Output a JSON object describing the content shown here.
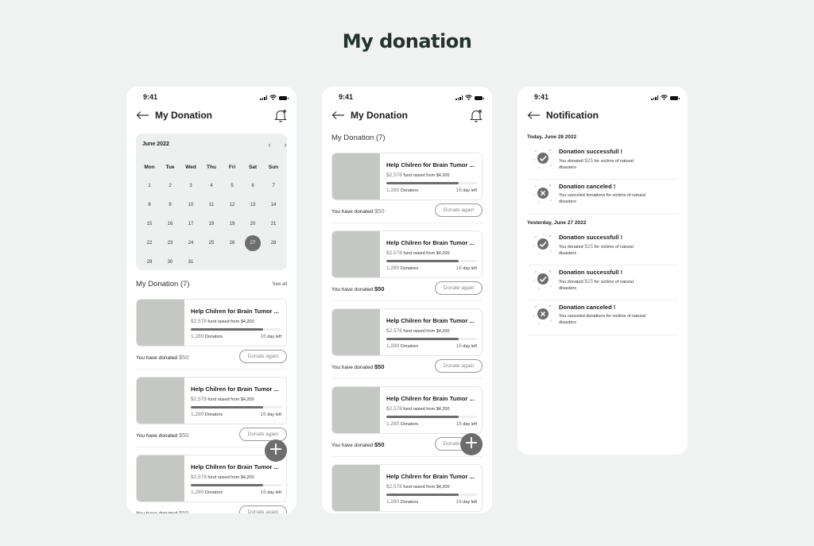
{
  "page_title": "My donation",
  "status": {
    "time": "9:41"
  },
  "screen1": {
    "title": "My Donation",
    "calendar": {
      "month": "June 2022",
      "weekdays": [
        "Mon",
        "Tue",
        "Wed",
        "Thu",
        "Fri",
        "Sat",
        "Sun"
      ],
      "weeks": [
        [
          "1",
          "2",
          "3",
          "4",
          "5",
          "6",
          "7"
        ],
        [
          "8",
          "9",
          "10",
          "11",
          "12",
          "13",
          "14"
        ],
        [
          "15",
          "16",
          "17",
          "18",
          "19",
          "20",
          "21"
        ],
        [
          "22",
          "23",
          "24",
          "25",
          "26",
          "27",
          "28"
        ],
        [
          "29",
          "30",
          "31",
          "",
          "",
          "",
          ""
        ]
      ],
      "selected": "27"
    },
    "section_title": "My Donation (7)",
    "see_all": "See all"
  },
  "screen2": {
    "title": "My Donation",
    "section_title": "My Donation (7)"
  },
  "card": {
    "title": "Help Chilren for Brain Tumor ...",
    "raised_amount": "$2,578",
    "raised_text": "fund raised from $4,200",
    "progress": 0.8,
    "donators_count": "1,280",
    "donators_label": "Donators",
    "days_count": "16",
    "days_label": "day left",
    "donated_prefix": "You have donated",
    "donated_value": "$50",
    "donate_again": "Donate again"
  },
  "screen3": {
    "title": "Notification",
    "groups": [
      {
        "date": "Today, June 28 2022",
        "items": [
          {
            "type": "success",
            "title": "Donation successfull !",
            "desc_prefix": "You donated",
            "amount": "$25",
            "desc_suffix": "for victims of natural disasters"
          },
          {
            "type": "cancel",
            "title": "Donation canceled !",
            "desc_prefix": "You canceled donations for victims of natural disasters",
            "amount": "",
            "desc_suffix": ""
          }
        ]
      },
      {
        "date": "Yesterday, June 27 2022",
        "items": [
          {
            "type": "success",
            "title": "Donation successfull !",
            "desc_prefix": "You donated",
            "amount": "$25",
            "desc_suffix": "for victims of natural disasters"
          },
          {
            "type": "success",
            "title": "Donation successfull !",
            "desc_prefix": "You donated",
            "amount": "$25",
            "desc_suffix": "for victims of natural disasters"
          },
          {
            "type": "cancel",
            "title": "Donation canceled !",
            "desc_prefix": "You canceled donations for victims of natural disasters",
            "amount": "",
            "desc_suffix": ""
          }
        ]
      }
    ]
  },
  "colors": {
    "background": "#eff2f0",
    "accent": "#6d6d6d",
    "thumb": "#c5c7c5",
    "title": "#24332e"
  },
  "icons": [
    "back-arrow-icon",
    "bell-icon",
    "chevron-left-icon",
    "chevron-right-icon",
    "plus-icon",
    "check-circle-icon",
    "x-circle-icon",
    "signal-icon",
    "wifi-icon",
    "battery-icon"
  ]
}
